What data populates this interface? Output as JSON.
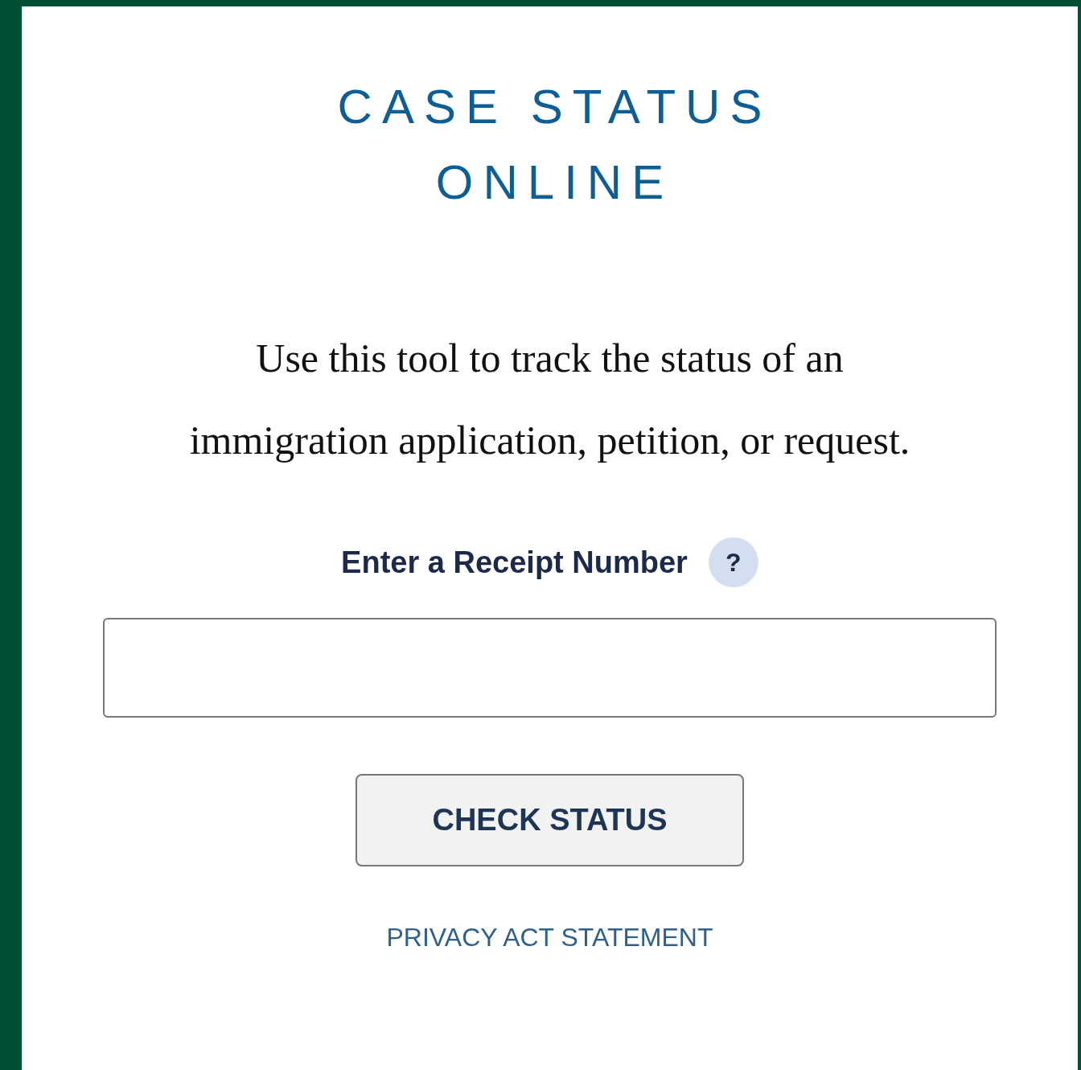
{
  "title": "CASE STATUS ONLINE",
  "intro": "Use this tool to track the status of an immigration application, petition, or request.",
  "receipt": {
    "label": "Enter a Receipt Number",
    "help": "?"
  },
  "button": "CHECK STATUS",
  "privacy_link": "PRIVACY ACT STATEMENT"
}
